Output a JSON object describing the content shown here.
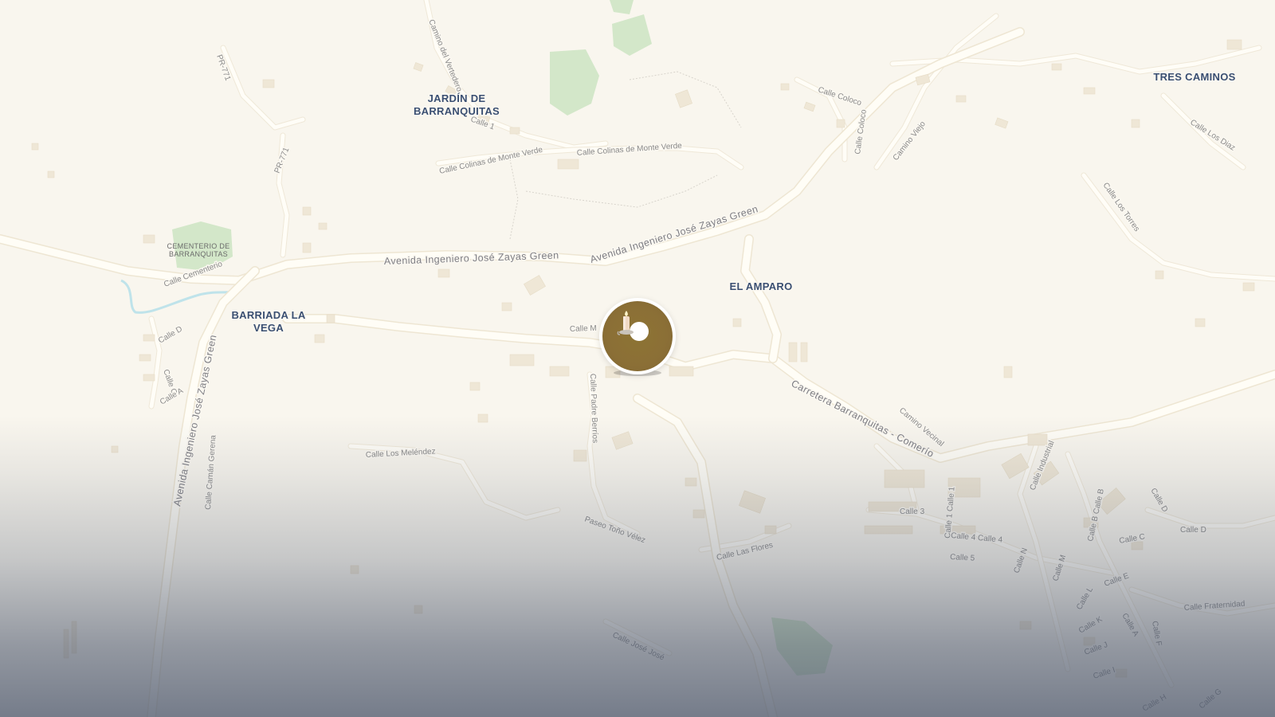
{
  "map": {
    "places": {
      "jardin_line1": "JARDÍN DE",
      "jardin_line2": "BARRANQUITAS",
      "tres_caminos": "TRES CAMINOS",
      "el_amparo": "EL AMPARO",
      "barriada_line1": "BARRIADA LA",
      "barriada_line2": "VEGA"
    },
    "poi": {
      "cemetery_line1": "CEMENTERIO DE",
      "cemetery_line2": "BARRANQUITAS"
    },
    "streets": {
      "avenida_1": "Avenida Ingeniero José Zayas Green",
      "avenida_2": "Avenida Ingeniero José Zayas Green",
      "avenida_vertical": "Avenida Ingeniero José Zayas Green",
      "carretera": "Carretera Barranquitas - Comerío",
      "pr771_a": "PR-771",
      "pr771_b": "PR-771",
      "camino_vertedero": "Camino del Vertedero",
      "calle_1_top": "Calle 1",
      "colinas_1": "Calle Colinas de Monte Verde",
      "colinas_2": "Calle Colinas de Monte Verde",
      "coloco_1": "Calle Coloco",
      "coloco_2": "Calle Coloco",
      "camino_viejo": "Camino Viejo",
      "los_diaz": "Calle Los Diaz",
      "los_torres": "Calle Los Torres",
      "cementerio_st": "Calle Cementerio",
      "calle_d_left": "Calle D",
      "calle_c_left": "Calle C",
      "calle_a_left": "Calle A",
      "calle_m_center": "Calle M",
      "padre_berrios": "Calle Padre Berríos",
      "los_melendez": "Calle Los Meléndez",
      "caman_gerena": "Calle Camán Gerena",
      "paseo_tono": "Paseo Toño Vélez",
      "las_flores": "Calle Las Flores",
      "jose_jose": "Calle José José",
      "camino_vecinal": "Camino Vecinal",
      "industrial": "Calle Industrial",
      "calle_3": "Calle 3",
      "calle_1_right": "Calle 1 Calle 1",
      "calle_4": "Calle 4 Calle 4",
      "calle_5": "Calle 5",
      "calle_n": "Calle N",
      "calle_m_right": "Calle M",
      "calle_b": "Calle B Calle B",
      "calle_c_right": "Calle C",
      "calle_d_right1": "Calle D",
      "calle_d_right2": "Calle D",
      "calle_e": "Calle E",
      "calle_l": "Calle L",
      "calle_k": "Calle K",
      "calle_j": "Calle J",
      "calle_i": "Calle I",
      "calle_h": "Calle H",
      "calle_g": "Calle G",
      "calle_a_right": "Calle A",
      "calle_f": "Calle F",
      "fraternidad": "Calle Fraternidad"
    },
    "marker": {
      "icon": "candle-icon",
      "color": "#8b6f36"
    }
  }
}
